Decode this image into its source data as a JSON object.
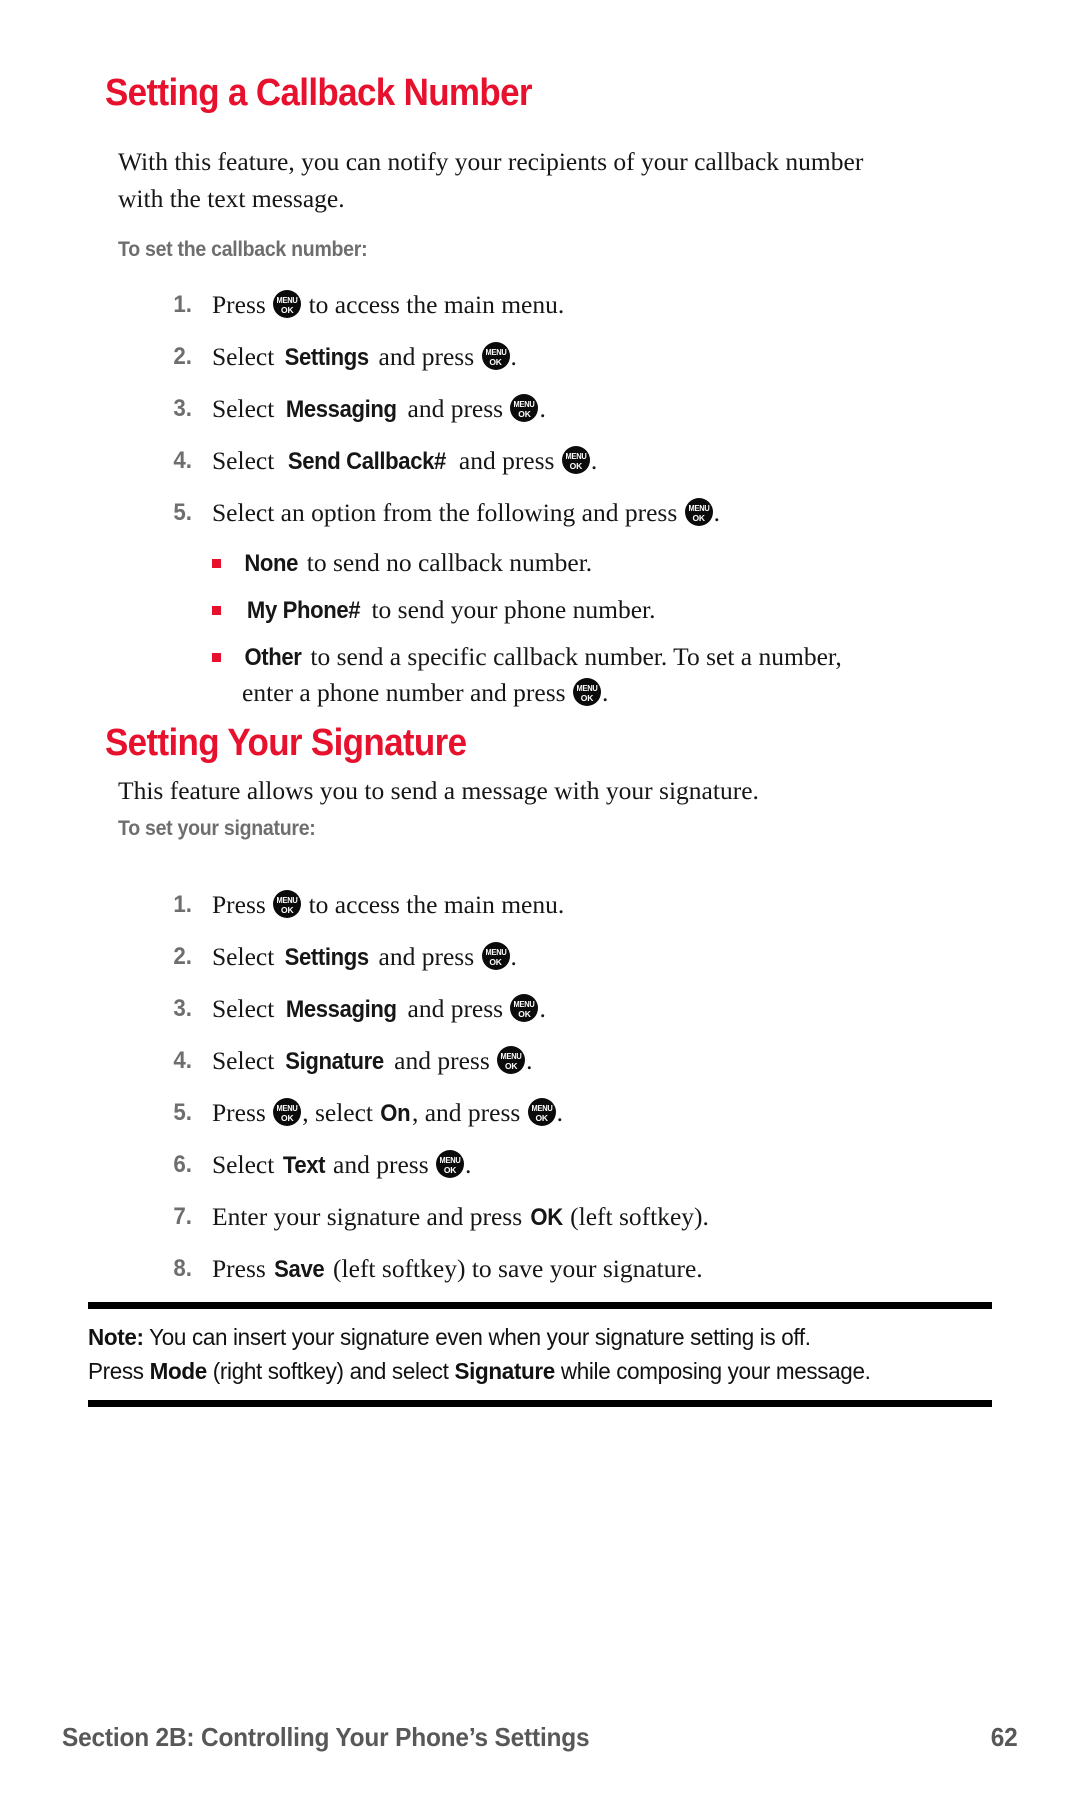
{
  "colors": {
    "heading_red": "#E8112D",
    "bullet_red": "#E8112D",
    "subhead_gray": "#6E6E6E",
    "number_gray": "#6E6E6E",
    "footer_gray": "#585858",
    "body_black": "#161616",
    "rule_black": "#000000",
    "key_icon_bg": "#0B0B0B"
  },
  "key_icon": {
    "name": "menu-ok-key-icon",
    "line1": "MENU",
    "line2": "OK"
  },
  "sections": [
    {
      "heading": "Setting a Callback Number",
      "intro": "With this feature, you can notify your recipients of your callback number with the text message.",
      "subhead": "To set the callback number:",
      "steps": [
        {
          "num": "1.",
          "parts": [
            {
              "t": "text",
              "v": "Press "
            },
            {
              "t": "key"
            },
            {
              "t": "text",
              "v": " to access the main menu."
            }
          ]
        },
        {
          "num": "2.",
          "parts": [
            {
              "t": "text",
              "v": "Select "
            },
            {
              "t": "ui",
              "v": "Settings"
            },
            {
              "t": "text",
              "v": " and press "
            },
            {
              "t": "key"
            },
            {
              "t": "text",
              "v": "."
            }
          ]
        },
        {
          "num": "3.",
          "parts": [
            {
              "t": "text",
              "v": "Select "
            },
            {
              "t": "ui",
              "v": "Messaging"
            },
            {
              "t": "text",
              "v": " and press "
            },
            {
              "t": "key"
            },
            {
              "t": "text",
              "v": "."
            }
          ]
        },
        {
          "num": "4.",
          "parts": [
            {
              "t": "text",
              "v": "Select "
            },
            {
              "t": "ui",
              "v": "Send Callback#"
            },
            {
              "t": "text",
              "v": " and press "
            },
            {
              "t": "key"
            },
            {
              "t": "text",
              "v": "."
            }
          ]
        },
        {
          "num": "5.",
          "parts": [
            {
              "t": "text",
              "v": "Select an option from the following and press "
            },
            {
              "t": "key"
            },
            {
              "t": "text",
              "v": "."
            }
          ]
        }
      ],
      "bullets": [
        {
          "parts": [
            {
              "t": "ui",
              "v": "None"
            },
            {
              "t": "text",
              "v": " to send no callback number."
            }
          ]
        },
        {
          "parts": [
            {
              "t": "ui",
              "v": "My Phone#"
            },
            {
              "t": "text",
              "v": " to send your phone number."
            }
          ]
        },
        {
          "parts": [
            {
              "t": "ui",
              "v": "Other"
            },
            {
              "t": "text",
              "v": " to send a specific callback number. To set a number,"
            },
            {
              "t": "br"
            },
            {
              "t": "text",
              "v": "enter a phone number and press "
            },
            {
              "t": "key"
            },
            {
              "t": "text",
              "v": "."
            }
          ]
        }
      ]
    },
    {
      "heading": "Setting Your Signature",
      "intro": "This feature allows you to send a message with your signature.",
      "subhead": "To set your signature:",
      "steps": [
        {
          "num": "1.",
          "parts": [
            {
              "t": "text",
              "v": "Press "
            },
            {
              "t": "key"
            },
            {
              "t": "text",
              "v": " to access the main menu."
            }
          ]
        },
        {
          "num": "2.",
          "parts": [
            {
              "t": "text",
              "v": "Select "
            },
            {
              "t": "ui",
              "v": "Settings"
            },
            {
              "t": "text",
              "v": " and press "
            },
            {
              "t": "key"
            },
            {
              "t": "text",
              "v": "."
            }
          ]
        },
        {
          "num": "3.",
          "parts": [
            {
              "t": "text",
              "v": "Select "
            },
            {
              "t": "ui",
              "v": "Messaging"
            },
            {
              "t": "text",
              "v": " and press "
            },
            {
              "t": "key"
            },
            {
              "t": "text",
              "v": "."
            }
          ]
        },
        {
          "num": "4.",
          "parts": [
            {
              "t": "text",
              "v": "Select "
            },
            {
              "t": "ui",
              "v": "Signature"
            },
            {
              "t": "text",
              "v": " and press "
            },
            {
              "t": "key"
            },
            {
              "t": "text",
              "v": "."
            }
          ]
        },
        {
          "num": "5.",
          "parts": [
            {
              "t": "text",
              "v": "Press "
            },
            {
              "t": "key"
            },
            {
              "t": "text",
              "v": ", select "
            },
            {
              "t": "ui",
              "v": "On"
            },
            {
              "t": "text",
              "v": ", and press "
            },
            {
              "t": "key"
            },
            {
              "t": "text",
              "v": "."
            }
          ]
        },
        {
          "num": "6.",
          "parts": [
            {
              "t": "text",
              "v": "Select "
            },
            {
              "t": "ui",
              "v": "Text"
            },
            {
              "t": "text",
              "v": " and press "
            },
            {
              "t": "key"
            },
            {
              "t": "text",
              "v": "."
            }
          ]
        },
        {
          "num": "7.",
          "parts": [
            {
              "t": "text",
              "v": "Enter your signature and press "
            },
            {
              "t": "ui",
              "v": "OK"
            },
            {
              "t": "text",
              "v": " (left softkey)."
            }
          ]
        },
        {
          "num": "8.",
          "parts": [
            {
              "t": "text",
              "v": "Press "
            },
            {
              "t": "ui",
              "v": "Save"
            },
            {
              "t": "text",
              "v": " (left softkey) to save your signature."
            }
          ]
        }
      ],
      "bullets": []
    }
  ],
  "note": {
    "label": "Note:",
    "line1_rest": " You can insert your signature even when your signature setting is off.",
    "line2": [
      {
        "t": "text",
        "v": "Press "
      },
      {
        "t": "b",
        "v": "Mode"
      },
      {
        "t": "text",
        "v": " (right softkey) and select "
      },
      {
        "t": "b",
        "v": "Signature"
      },
      {
        "t": "text",
        "v": " while composing your message."
      }
    ]
  },
  "footer": {
    "section_label": "Section 2B: Controlling Your Phone’s Settings",
    "page_number": "62"
  }
}
